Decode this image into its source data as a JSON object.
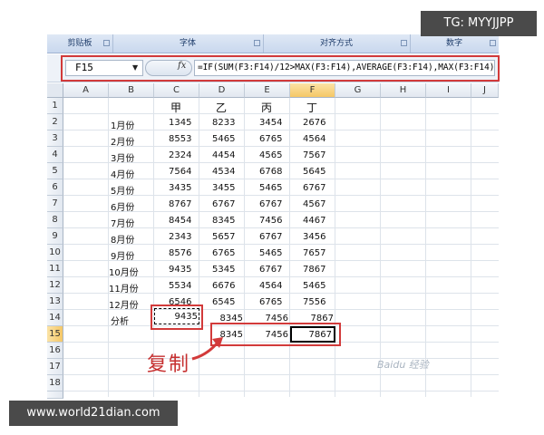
{
  "ribbon": {
    "groups": [
      "剪贴板",
      "字体",
      "对齐方式",
      "数字"
    ]
  },
  "formula_bar": {
    "name_box": "F15",
    "fx_symbol": "fx",
    "formula": "=IF(SUM(F3:F14)/12>MAX(F3:F14),AVERAGE(F3:F14),MAX(F3:F14))"
  },
  "columns": [
    "A",
    "B",
    "C",
    "D",
    "E",
    "F",
    "G",
    "H",
    "I",
    "J"
  ],
  "rows": [
    "1",
    "2",
    "3",
    "4",
    "5",
    "6",
    "7",
    "8",
    "9",
    "10",
    "11",
    "12",
    "13",
    "14",
    "15",
    "16",
    "17",
    "18"
  ],
  "sheet": {
    "headers": [
      "甲",
      "乙",
      "丙",
      "丁"
    ],
    "data": [
      {
        "month": "1月份",
        "v": [
          "1345",
          "8233",
          "3454",
          "2676"
        ]
      },
      {
        "month": "2月份",
        "v": [
          "8553",
          "5465",
          "6765",
          "4564"
        ]
      },
      {
        "month": "3月份",
        "v": [
          "2324",
          "4454",
          "4565",
          "7567"
        ]
      },
      {
        "month": "4月份",
        "v": [
          "7564",
          "4534",
          "6768",
          "5645"
        ]
      },
      {
        "month": "5月份",
        "v": [
          "3435",
          "3455",
          "5465",
          "6767"
        ]
      },
      {
        "month": "6月份",
        "v": [
          "8767",
          "6767",
          "6767",
          "4567"
        ]
      },
      {
        "month": "7月份",
        "v": [
          "8454",
          "8345",
          "7456",
          "4467"
        ]
      },
      {
        "month": "8月份",
        "v": [
          "2343",
          "5657",
          "6767",
          "3456"
        ]
      },
      {
        "month": "9月份",
        "v": [
          "8576",
          "6765",
          "5465",
          "7657"
        ]
      },
      {
        "month": "10月份",
        "v": [
          "9435",
          "5345",
          "6767",
          "7867"
        ]
      },
      {
        "month": "11月份",
        "v": [
          "5534",
          "6676",
          "4564",
          "5465"
        ]
      },
      {
        "month": "12月份",
        "v": [
          "6546",
          "6545",
          "6765",
          "7556"
        ]
      }
    ],
    "analysis_label": "分析",
    "analysis_row": [
      "9435",
      "8345",
      "7456",
      "7867"
    ],
    "row15": [
      "8345",
      "7456",
      "7867"
    ]
  },
  "annotation": {
    "copy_label": "复制"
  },
  "overlays": {
    "tg": "TG: MYYJJPP",
    "site": "www.world21dian.com",
    "watermark": "Baidu 经验"
  },
  "colors": {
    "highlight_red": "#d23a3a",
    "selected_header": "#f5c766",
    "ribbon_blue": "#c9d8ee"
  }
}
